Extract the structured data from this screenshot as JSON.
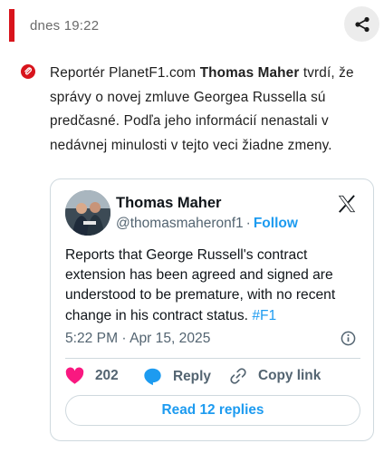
{
  "header": {
    "timestamp": "dnes 19:22",
    "share_icon": "share-icon",
    "accent_color": "#d8141c"
  },
  "article": {
    "bullet_icon": "paperclip-icon",
    "before": "Reportér PlanetF1.com ",
    "author": "Thomas Maher",
    "after": " tvrdí, že správy o novej zmluve Georgea Russella sú predčasné. Podľa jeho informácií nenastali v nedávnej minulosti v tejto veci žiadne zmeny."
  },
  "tweet": {
    "name": "Thomas Maher",
    "handle": "@thomasmaheronf1",
    "separator": "·",
    "follow_label": "Follow",
    "body": "Reports that George Russell's contract extension has been agreed and signed are understood to be premature, with no recent change in his contract status. ",
    "hashtag": "#F1",
    "date": "5:22 PM · Apr 15, 2025",
    "likes": "202",
    "reply_label": "Reply",
    "copy_label": "Copy link",
    "read_replies_label": "Read 12 replies",
    "link_color": "#1d9bf0",
    "like_color": "#f91880"
  }
}
